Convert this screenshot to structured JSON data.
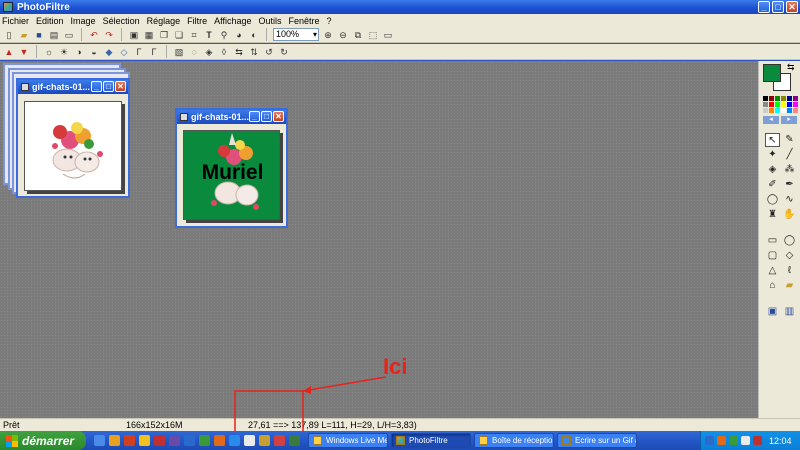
{
  "app": {
    "title": "PhotoFiltre"
  },
  "window_buttons": {
    "minimize": "_",
    "maximize": "□",
    "close": "✕"
  },
  "menu": [
    "Fichier",
    "Edition",
    "Image",
    "Sélection",
    "Réglage",
    "Filtre",
    "Affichage",
    "Outils",
    "Fenêtre",
    "?"
  ],
  "toolbar": {
    "zoom_value": "100%"
  },
  "documents": {
    "back": {
      "title": "gif-chats-01..."
    },
    "front": {
      "title": "gif-chats-01...",
      "overlay_text": "Muriel"
    }
  },
  "colors": {
    "foreground": "#0a8a3c",
    "background": "#ffffff",
    "accent": "#3a6cde",
    "annotation": "#e8221b"
  },
  "status": {
    "state": "Prêt",
    "image_info": "166x152x16M",
    "selection_info": "27,61 ==> 137,89 L=111, H=29, L/H=3,83)"
  },
  "annotation": {
    "label": "Ici"
  },
  "taskbar": {
    "start_label": "démarrer",
    "tasks": [
      {
        "label": "Windows Live Me..."
      },
      {
        "label": "PhotoFiltre"
      },
      {
        "label": "Boîte de réception..."
      },
      {
        "label": "Ecrire sur un Gif a..."
      }
    ],
    "clock": "12:04"
  }
}
